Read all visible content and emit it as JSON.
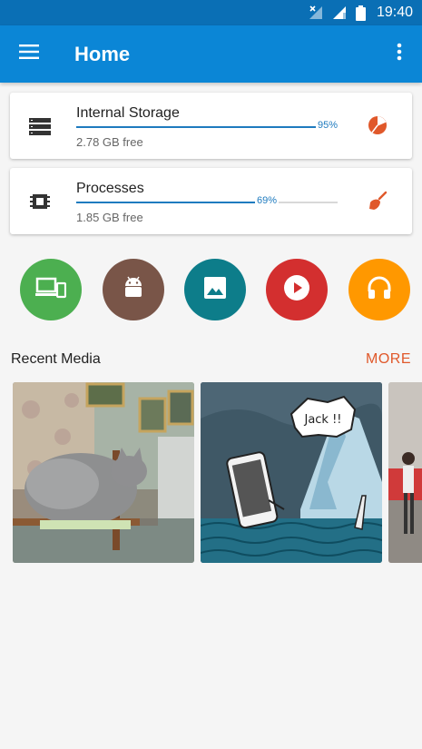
{
  "status_bar": {
    "time": "19:40"
  },
  "app_bar": {
    "title": "Home"
  },
  "storage_cards": [
    {
      "name": "Internal Storage",
      "free": "2.78 GB free",
      "percent_label": "95%",
      "percent": 95
    },
    {
      "name": "Processes",
      "free": "1.85 GB free",
      "percent_label": "69%",
      "percent": 69
    }
  ],
  "quick_actions": [
    {
      "icon": "apps-devices-icon",
      "color": "#4caf50"
    },
    {
      "icon": "android-icon",
      "color": "#795548"
    },
    {
      "icon": "image-icon",
      "color": "#0d7d8a"
    },
    {
      "icon": "video-play-icon",
      "color": "#d32f2f"
    },
    {
      "icon": "headphones-icon",
      "color": "#ff9800"
    }
  ],
  "recent_media": {
    "title": "Recent Media",
    "more_label": "MORE",
    "caption_text": "Jack !!",
    "items": [
      "cat-sleeping-photo",
      "phone-titanic-cartoon",
      "partial-photo"
    ]
  },
  "colors": {
    "app_bar": "#0b86d6",
    "status_bar": "#0a6fb5",
    "accent": "#e0582a",
    "progress": "#1f7bbf"
  }
}
